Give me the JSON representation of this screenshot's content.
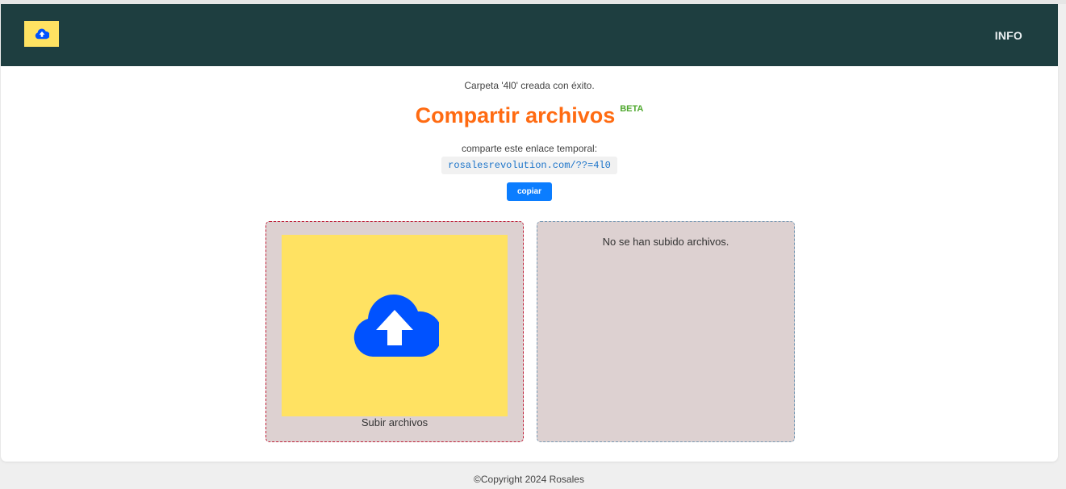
{
  "nav": {
    "logo_icon": "cloud-upload-icon",
    "info_label": "INFO"
  },
  "main": {
    "status_message": "Carpeta '4l0' creada con éxito.",
    "title": "Compartir archivos",
    "beta_badge": "BETA",
    "share_label": "comparte este enlace temporal:",
    "share_link": "rosalesrevolution.com/??=4l0",
    "copy_button": "copiar"
  },
  "upload": {
    "icon": "cloud-upload-icon",
    "label": "Subir archivos"
  },
  "files": {
    "empty_message": "No se han subido archivos."
  },
  "footer": {
    "copyright": "©Copyright 2024 Rosales"
  },
  "colors": {
    "navbar": "#1e3e40",
    "logo_bg": "#ffe262",
    "title": "#ff6b12",
    "beta": "#4fa82e",
    "button": "#0b7dff",
    "icon_blue": "#0052ff"
  }
}
